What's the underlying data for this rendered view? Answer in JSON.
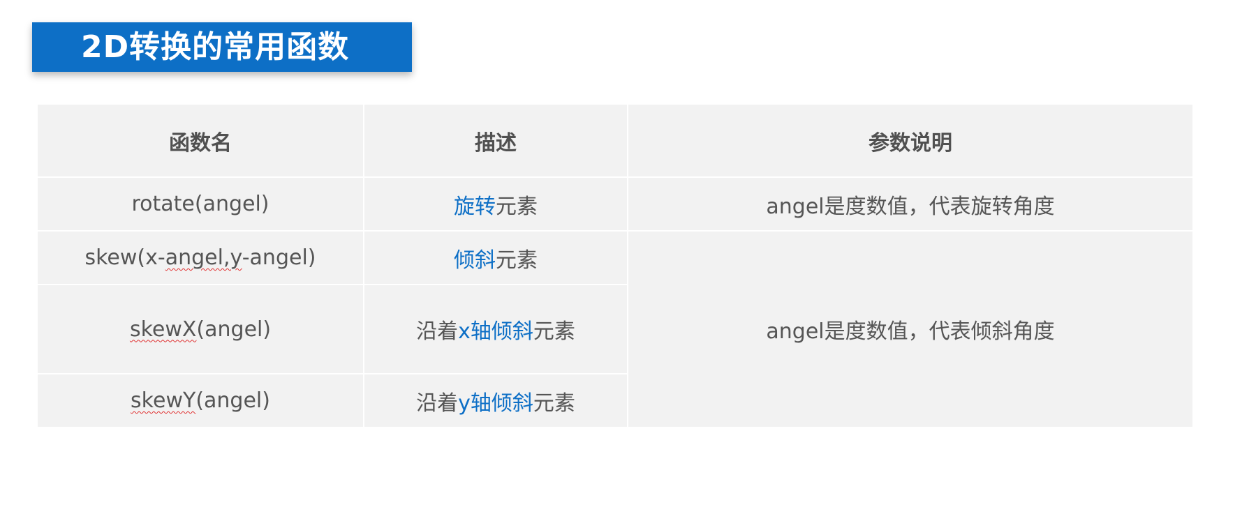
{
  "title": "2D转换的常用函数",
  "table": {
    "headers": [
      "函数名",
      "描述",
      "参数说明"
    ],
    "rows": [
      {
        "func": "rotate(angel)",
        "desc_highlight": "旋转",
        "desc_rest": "元素",
        "param": "angel是度数值，代表旋转角度"
      },
      {
        "func_pre": "skew(x-",
        "func_mark1": "angel,y",
        "func_post": "-angel)",
        "desc_highlight": "倾斜",
        "desc_rest": "元素",
        "param": "angel是度数值，代表倾斜角度"
      },
      {
        "func_mark": "skewX",
        "func_post": "(angel)",
        "desc_pre": "沿着",
        "desc_highlight": "x轴倾斜",
        "desc_rest": "元素"
      },
      {
        "func_mark": "skewY",
        "func_post": "(angel)",
        "desc_pre": "沿着",
        "desc_highlight": "y轴倾斜",
        "desc_rest": "元素"
      }
    ]
  },
  "colors": {
    "accent": "#0d6fc6",
    "cell_bg": "#f2f2f2",
    "text": "#555555"
  }
}
